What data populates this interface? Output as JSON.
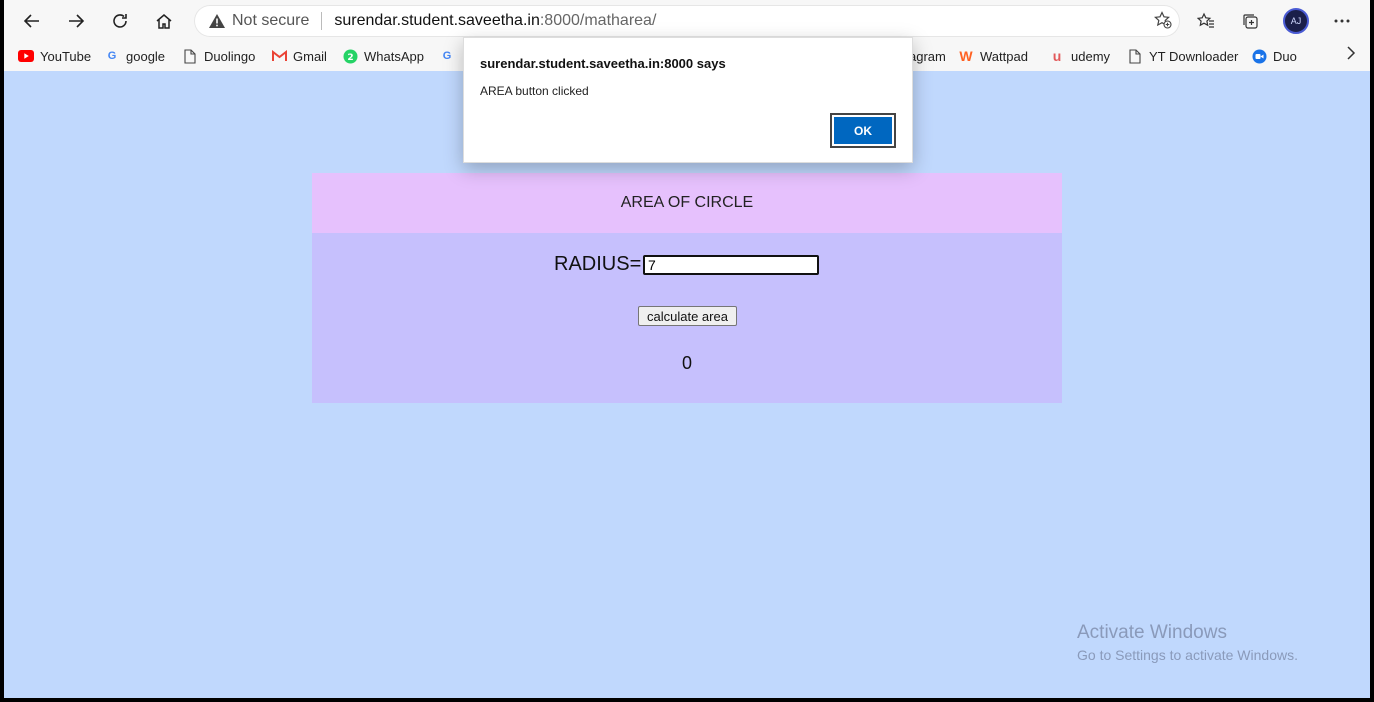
{
  "browser": {
    "address": {
      "security_label": "Not secure",
      "host": "surendar.student.saveetha.in",
      "path": ":8000/matharea/"
    },
    "bookmarks": [
      {
        "label": "YouTube",
        "icon": "youtube-icon",
        "color": "#ff0000"
      },
      {
        "label": "google",
        "icon": "google-icon",
        "color": "#4285f4"
      },
      {
        "label": "Duolingo",
        "icon": "page-icon",
        "color": "#444444"
      },
      {
        "label": "Gmail",
        "icon": "gmail-icon",
        "color": "#ea4335"
      },
      {
        "label": "WhatsApp",
        "icon": "whatsapp-icon",
        "color": "#25d366"
      },
      {
        "label": "agram",
        "icon": "",
        "color": ""
      },
      {
        "label": "Wattpad",
        "icon": "wattpad-icon",
        "color": "#ff6122"
      },
      {
        "label": "udemy",
        "icon": "udemy-icon",
        "color": "#a435f0"
      },
      {
        "label": "YT Downloader",
        "icon": "page-icon",
        "color": "#444444"
      },
      {
        "label": "Duo",
        "icon": "duo-icon",
        "color": "#1a73e8"
      }
    ],
    "avatar_text": "AJ"
  },
  "page": {
    "background": "#c0d8fd",
    "header_title": "AREA OF CIRCLE",
    "radius_label": "RADIUS=",
    "radius_value": "7",
    "calc_button_label": "calculate area",
    "result": "0"
  },
  "dialog": {
    "title": "surendar.student.saveetha.in:8000 says",
    "message": "AREA button clicked",
    "ok_label": "OK"
  },
  "watermark": {
    "title": "Activate Windows",
    "subtitle": "Go to Settings to activate Windows."
  }
}
